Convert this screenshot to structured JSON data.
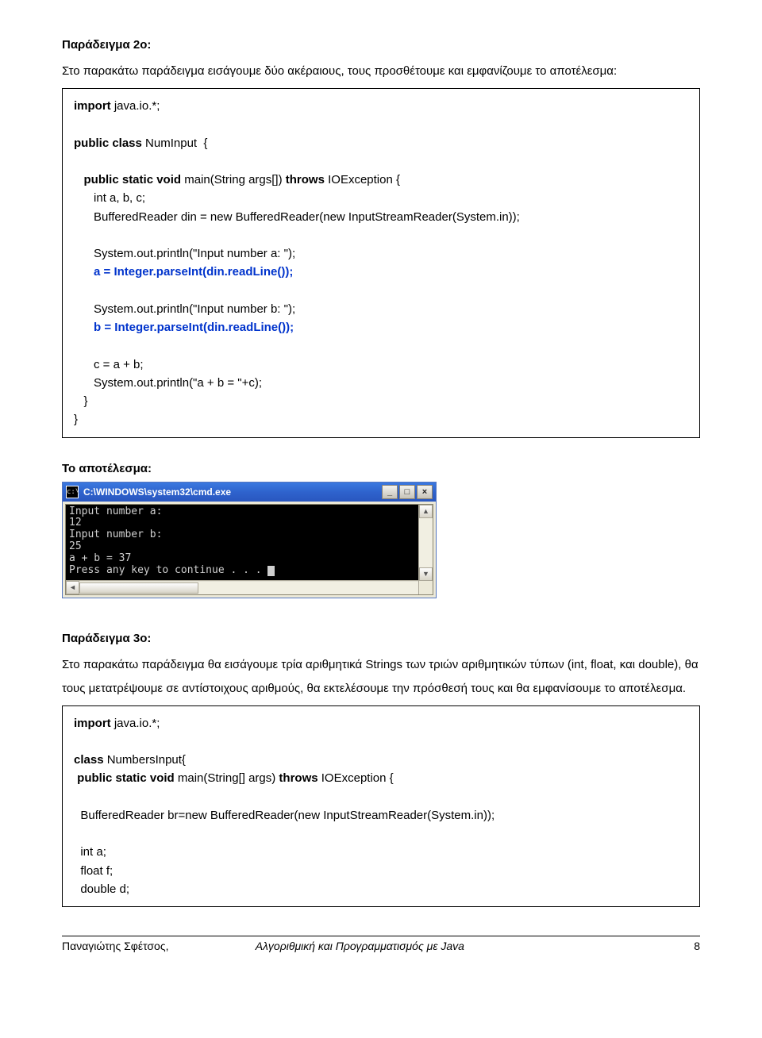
{
  "example2": {
    "title": "Παράδειγμα 2ο:",
    "intro": "Στο παρακάτω παράδειγμα εισάγουμε δύο ακέραιους, τους προσθέτουμε και εμφανίζουμε το αποτέλεσμα:",
    "code": {
      "l1a": "import",
      "l1b": " java.io.*;",
      "l2a": "public class",
      "l2b": " NumInput  {",
      "l3a": "public static void",
      "l3b": " main(String args[]) ",
      "l3c": "throws",
      "l3d": " IOException {",
      "l4": "      int a, b, c;",
      "l5": "      BufferedReader din = new BufferedReader(new InputStreamReader(System.in));",
      "l6": "      System.out.println(\"Input number a: \");",
      "l7": "      a = Integer.parseInt(din.readLine());",
      "l8": "      System.out.println(\"Input number b: \");",
      "l9": "      b = Integer.parseInt(din.readLine());",
      "l10": "      c = a + b;",
      "l11": "      System.out.println(\"a + b = \"+c);",
      "l12": "   }",
      "l13": "}"
    }
  },
  "result_label": "Το αποτέλεσμα:",
  "console": {
    "title": "C:\\WINDOWS\\system32\\cmd.exe",
    "icon_label": "c:\\",
    "min": "_",
    "max": "□",
    "close": "×",
    "line1": "Input number a:",
    "line2": "12",
    "line3": "Input number b:",
    "line4": "25",
    "line5": "a + b = 37",
    "line6": "Press any key to continue . . . ",
    "arrows": {
      "up": "▲",
      "down": "▼",
      "left": "◄",
      "right": "►"
    }
  },
  "example3": {
    "title": "Παράδειγμα 3ο:",
    "intro": "Στο παρακάτω παράδειγμα θα εισάγουμε τρία αριθμητικά Strings των τριών αριθμητικών τύπων (int, float, και double), θα τους μετατρέψουμε σε αντίστοιχους αριθμούς, θα εκτελέσουμε την πρόσθεσή τους και θα εμφανίσουμε το αποτέλεσμα.",
    "code": {
      "l1a": "import",
      "l1b": " java.io.*;",
      "l2a": "class",
      "l2b": " NumbersInput{",
      "l3a": " public static void",
      "l3b": " main(String[] args) ",
      "l3c": "throws",
      "l3d": " IOException {",
      "l4": "  BufferedReader br=new BufferedReader(new InputStreamReader(System.in));",
      "l5": "  int a;",
      "l6": "  float f;",
      "l7": "  double d;"
    }
  },
  "footer": {
    "author": "Παναγιώτης Σφέτσος,",
    "course": "Αλγοριθμική και Προγραμματισμός με Java",
    "page": "8"
  }
}
